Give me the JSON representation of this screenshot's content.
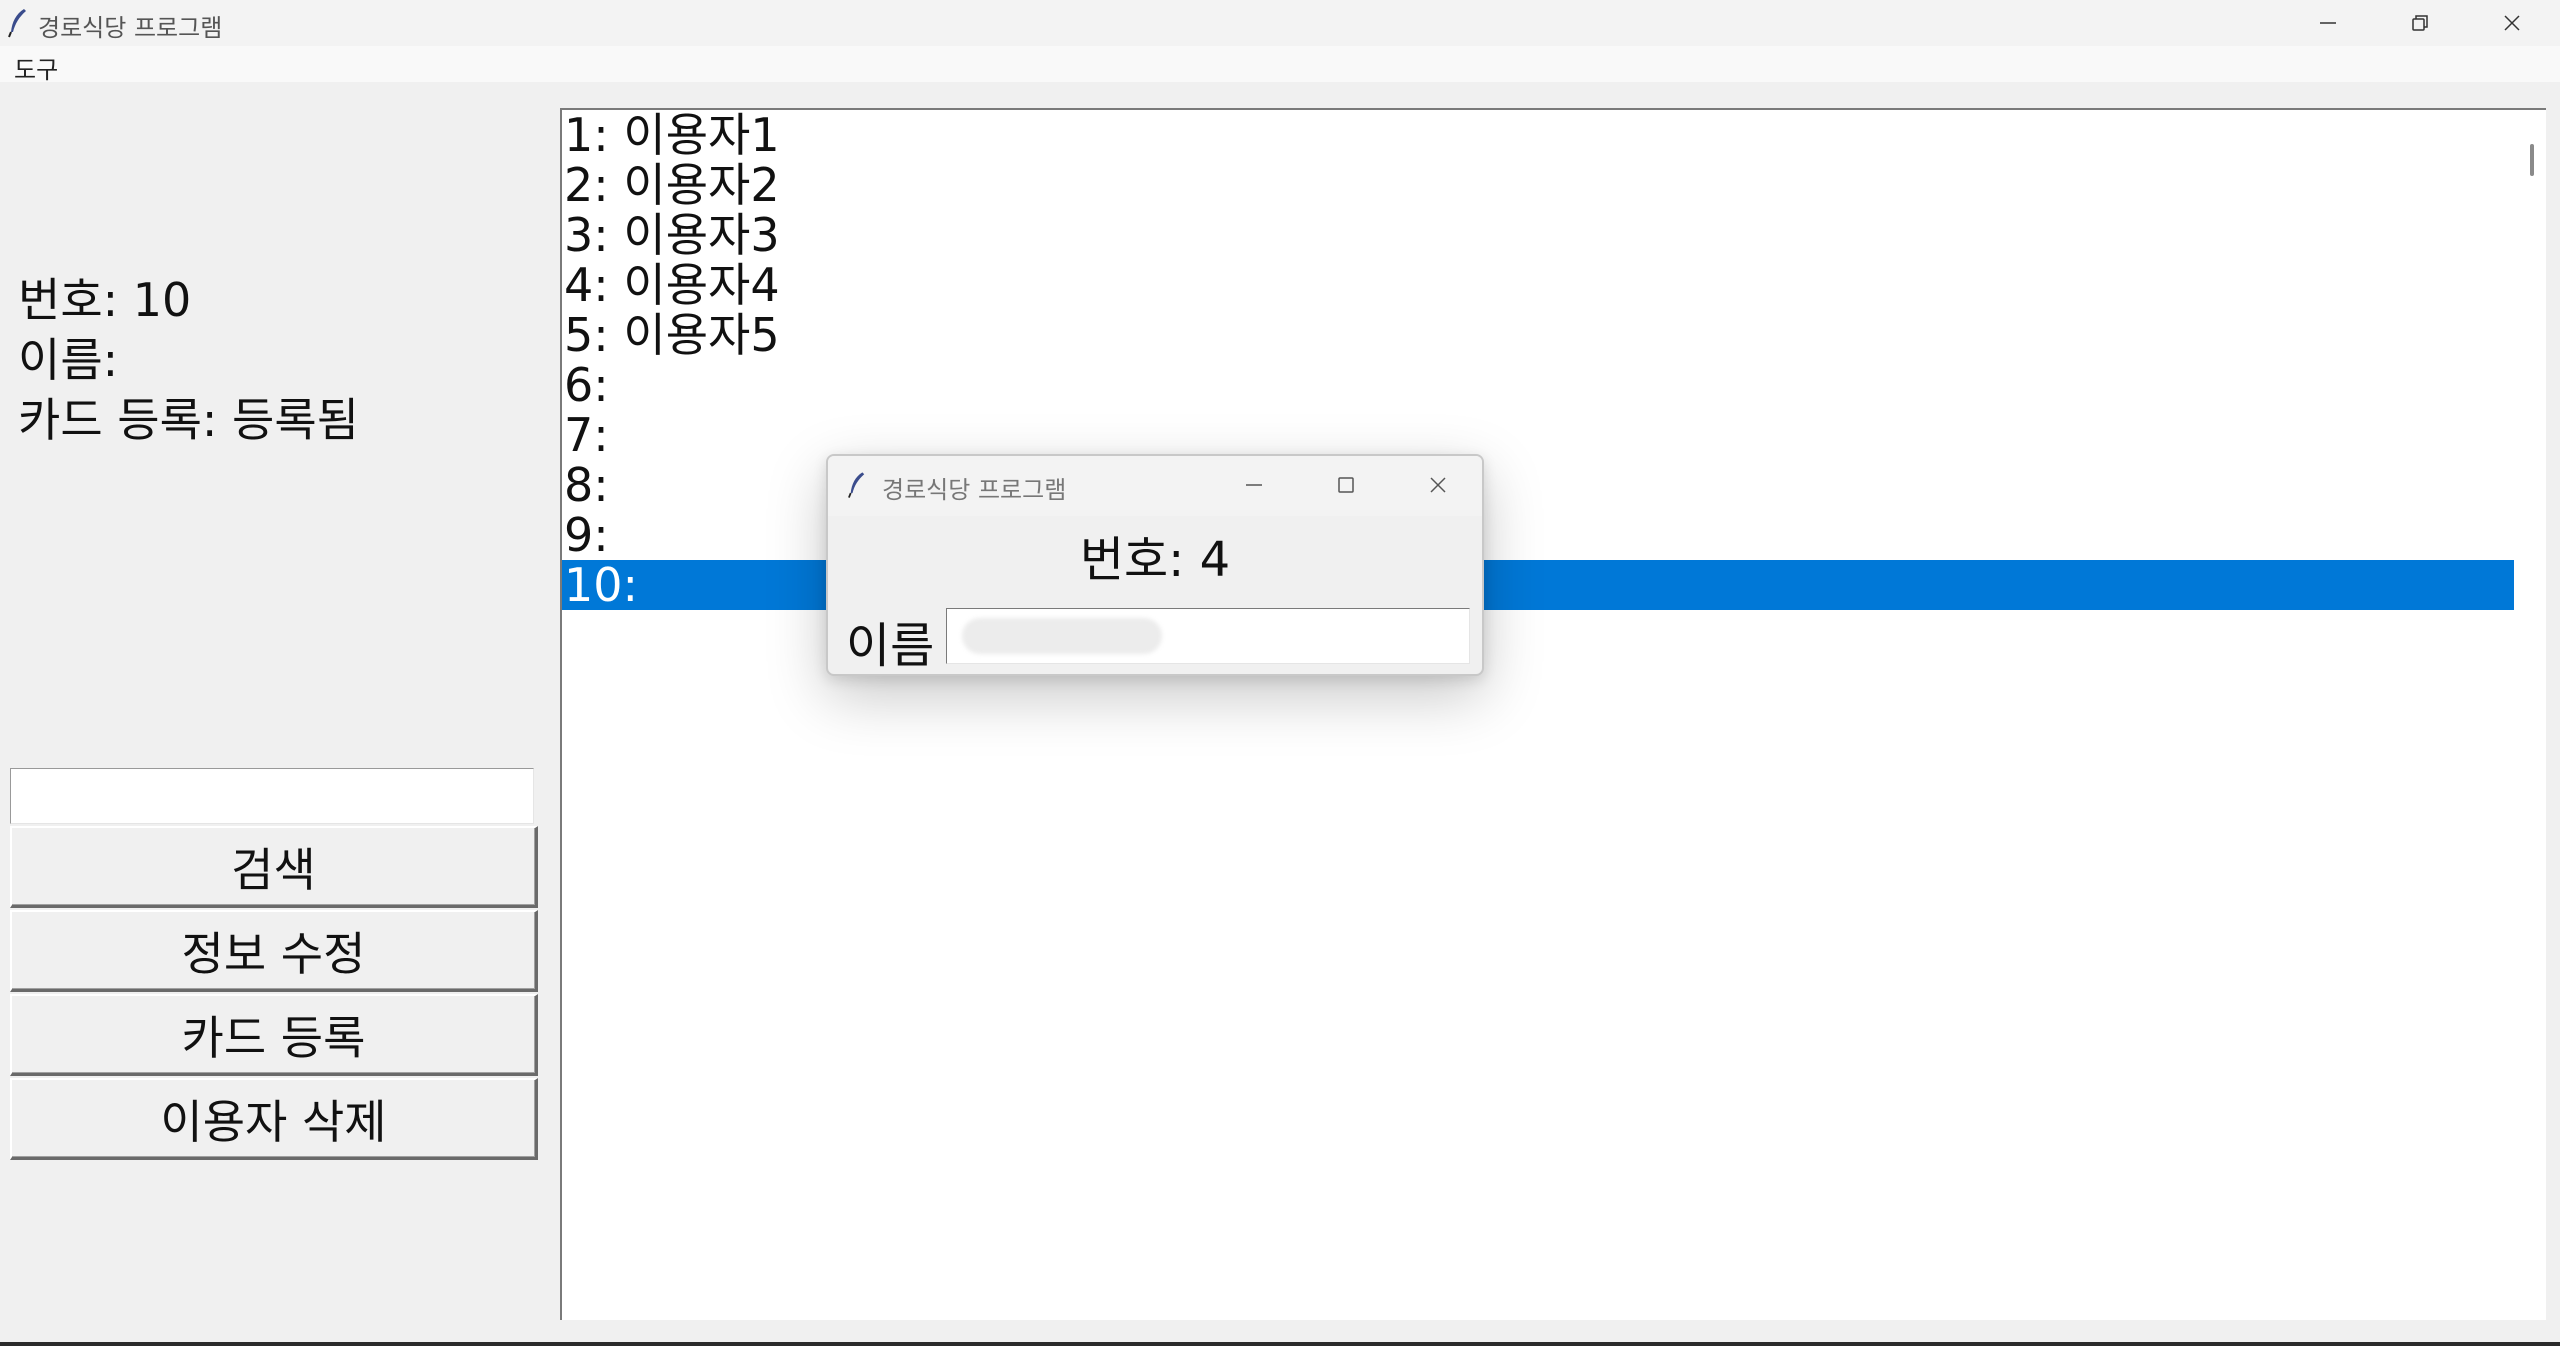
{
  "window": {
    "title": "경로식당 프로그램",
    "icon": "feather-icon"
  },
  "menubar": {
    "items": [
      {
        "label": "도구"
      }
    ]
  },
  "info": {
    "number_line": "번호: 10",
    "name_line": "이름:",
    "card_line": "카드 등록: 등록됨"
  },
  "search": {
    "value": "",
    "placeholder": ""
  },
  "buttons": {
    "search": "검색",
    "edit": "정보 수정",
    "card": "카드 등록",
    "delete": "이용자 삭제"
  },
  "list": {
    "items": [
      {
        "label": "1: 이용자1"
      },
      {
        "label": "2: 이용자2"
      },
      {
        "label": "3: 이용자3"
      },
      {
        "label": "4: 이용자4"
      },
      {
        "label": "5: 이용자5"
      },
      {
        "label": "6:"
      },
      {
        "label": "7:"
      },
      {
        "label": "8:"
      },
      {
        "label": "9:"
      },
      {
        "label": "10:"
      }
    ],
    "selected_index": 9,
    "selection_color": "#0078d7"
  },
  "dialog": {
    "title": "경로식당 프로그램",
    "number_line": "번호: 4",
    "name_label": "이름",
    "name_value": ""
  }
}
